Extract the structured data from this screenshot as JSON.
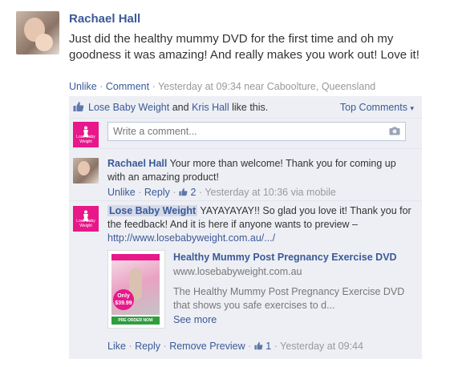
{
  "post": {
    "author": "Rachael Hall",
    "message": "Just did the healthy mummy DVD for the first time and oh my goodness it was amazing! And really makes you work out! Love it!",
    "actions": {
      "unlike": "Unlike",
      "comment": "Comment",
      "separator": "·"
    },
    "timestamp": "Yesterday at 09:34 near Caboolture, Queensland"
  },
  "likes": {
    "user1": "Lose Baby Weight",
    "and": "and",
    "user2": "Kris Hall",
    "suffix": "like this.",
    "sort_label": "Top Comments",
    "sort_arrow": "▾"
  },
  "composer": {
    "placeholder": "Write a comment...",
    "logo_text": "Lose Baby Weight"
  },
  "comments": [
    {
      "author": "Rachael Hall",
      "text": "Your more than welcome! Thank you for coming up with an amazing product!",
      "like_label": "Unlike",
      "reply_label": "Reply",
      "like_count": "2",
      "meta": "Yesterday at 10:36 via mobile"
    },
    {
      "author": "Lose Baby Weight",
      "text": "YAYAYAYAY!! So glad you love it! Thank you for the feedback! And it is here if anyone wants to preview –",
      "link": "http://www.losebabyweight.com.au/.../",
      "attachment": {
        "title": "Healthy Mummy Post Pregnancy Exercise DVD",
        "domain": "www.losebabyweight.com.au",
        "description": "The Healthy Mummy Post Pregnancy Exercise DVD that shows you safe exercises to d...",
        "see_more": "See more",
        "price_badge": "Only $39.99",
        "order_button": "PRE ORDER NOW"
      },
      "like_label": "Like",
      "reply_label": "Reply",
      "remove_preview_label": "Remove Preview",
      "like_count": "1",
      "meta": "Yesterday at 09:44"
    }
  ],
  "colors": {
    "link": "#3b5998",
    "ufi_bg": "#edeff4",
    "brand_pink": "#e8178a"
  }
}
